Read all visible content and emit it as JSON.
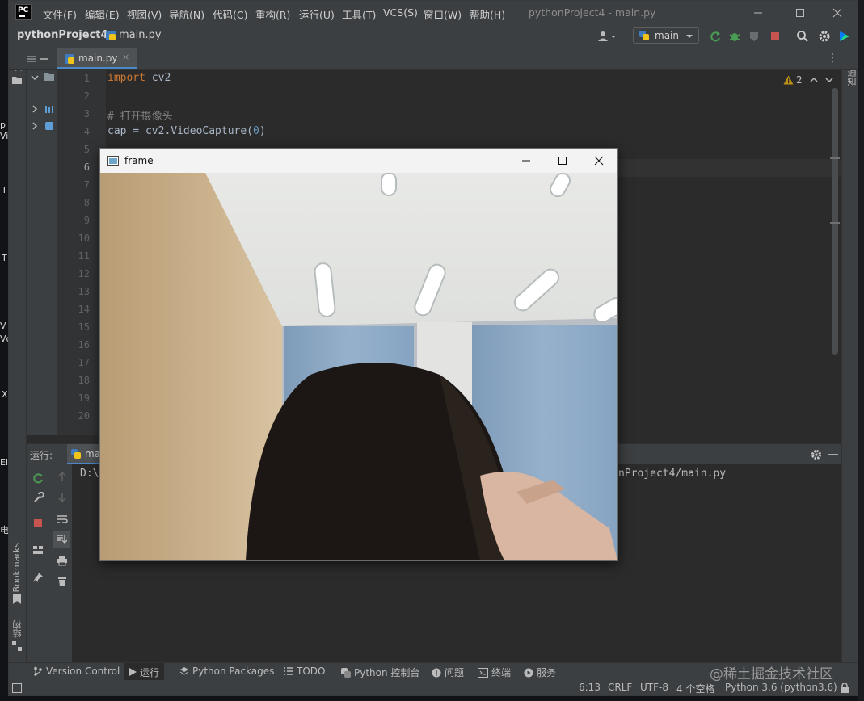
{
  "desktop": {
    "edge_glyphs": [
      "p",
      "Vi",
      "T",
      "T",
      "V",
      "Vc",
      "X",
      "Ei",
      "电"
    ]
  },
  "app": {
    "menu": [
      "文件(F)",
      "编辑(E)",
      "视图(V)",
      "导航(N)",
      "代码(C)",
      "重构(R)",
      "运行(U)",
      "工具(T)",
      "VCS(S)",
      "窗口(W)",
      "帮助(H)"
    ],
    "window_title": "pythonProject4 - main.py",
    "logo": "PC"
  },
  "toolbar": {
    "breadcrumb_project": "pythonProject4",
    "breadcrumb_file": "main.py",
    "run_config": "main"
  },
  "tabs": [
    {
      "label": "main.py"
    }
  ],
  "sidebar": {
    "project_label": "项目",
    "bookmarks_label": "Bookmarks",
    "structure_label": "结构",
    "notifications_label": "通知"
  },
  "editor": {
    "warnings_count": "2",
    "line_numbers": [
      "1",
      "2",
      "3",
      "4",
      "5",
      "6",
      "7",
      "8",
      "9",
      "10",
      "11",
      "12",
      "13",
      "14",
      "15",
      "16",
      "17",
      "18",
      "19",
      "20"
    ],
    "code": {
      "l1_kw": "import",
      "l1_rest": " cv2",
      "l3": "# 打开摄像头",
      "l4_a": "cap = cv2.VideoCapture(",
      "l4_num": "0",
      "l4_b": ")"
    }
  },
  "run_panel": {
    "label": "运行:",
    "config": "mai",
    "output_left": "D:\\",
    "output_right": "nProject4/main.py"
  },
  "frame_window": {
    "title": "frame"
  },
  "statusbar": {
    "tools": [
      "Version Control",
      "运行",
      "Python Packages",
      "TODO",
      "Python 控制台",
      "问题",
      "终端",
      "服务"
    ],
    "position": "6:13",
    "line_sep": "CRLF",
    "encoding": "UTF-8",
    "indent": "4 个空格",
    "interpreter": "Python 3.6 (python3.6)"
  },
  "watermark": "@稀土掘金技术社区",
  "colors": {
    "accent_green": "#499c54",
    "stop_red": "#c75450",
    "keyword": "#cc7832",
    "number": "#6897bb"
  }
}
